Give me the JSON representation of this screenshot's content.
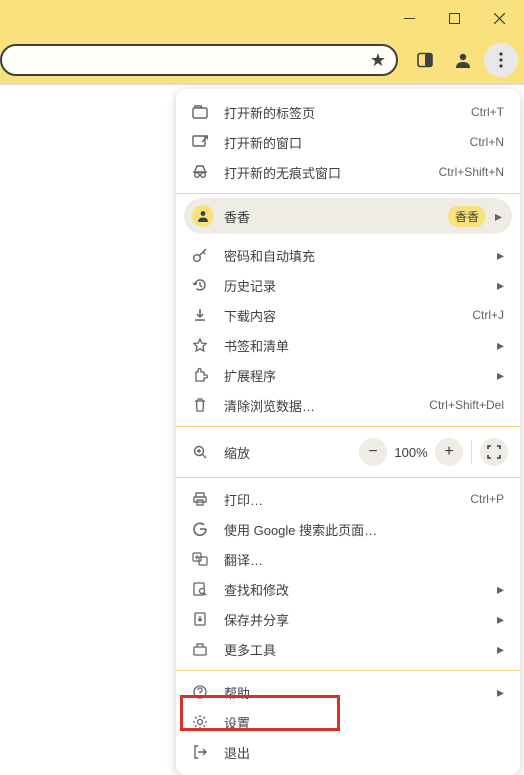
{
  "window": {
    "minimize": "─",
    "maximize": "□",
    "close": "✕"
  },
  "menu": {
    "new_tab": "打开新的标签页",
    "new_tab_sc": "Ctrl+T",
    "new_window": "打开新的窗口",
    "new_window_sc": "Ctrl+N",
    "incognito": "打开新的无痕式窗口",
    "incognito_sc": "Ctrl+Shift+N",
    "profile_name": "香香",
    "profile_badge": "香香",
    "passwords": "密码和自动填充",
    "history": "历史记录",
    "downloads": "下载内容",
    "downloads_sc": "Ctrl+J",
    "bookmarks": "书签和清单",
    "extensions": "扩展程序",
    "clear_data": "清除浏览数据…",
    "clear_data_sc": "Ctrl+Shift+Del",
    "zoom_label": "缩放",
    "zoom_value": "100%",
    "print": "打印…",
    "print_sc": "Ctrl+P",
    "search_page": "使用 Google 搜索此页面…",
    "translate": "翻译…",
    "find_edit": "查找和修改",
    "save_share": "保存并分享",
    "more_tools": "更多工具",
    "help": "帮助",
    "settings": "设置",
    "exit": "退出"
  }
}
